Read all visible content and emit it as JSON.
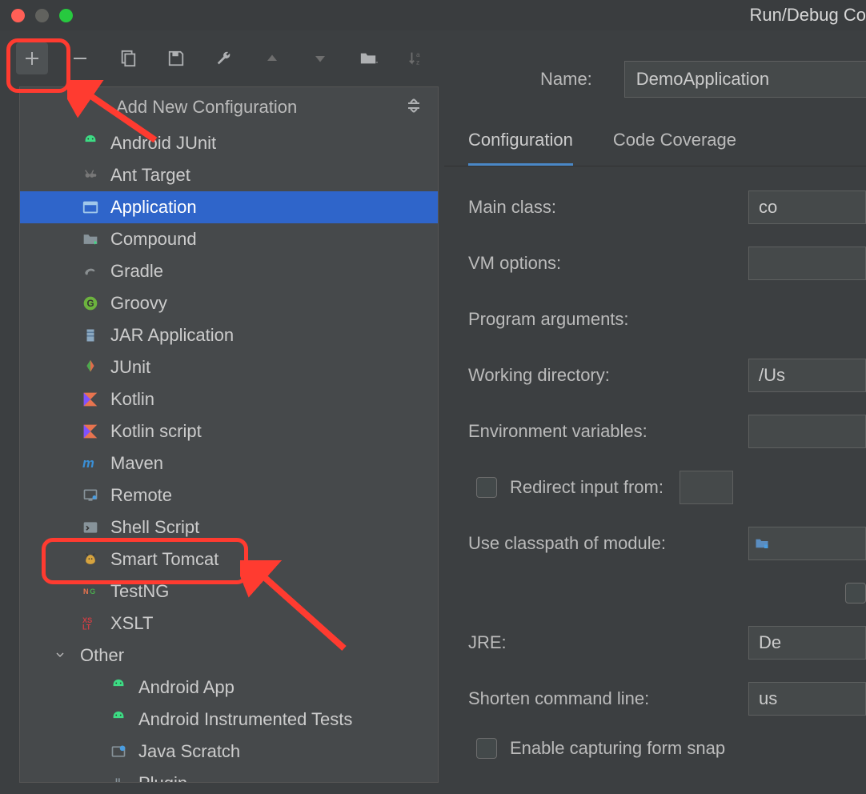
{
  "window": {
    "title": "Run/Debug Co"
  },
  "popup": {
    "title": "Add New Configuration",
    "items": [
      {
        "label": "Android JUnit",
        "icon": "android",
        "color": "#3ddc84"
      },
      {
        "label": "Ant Target",
        "icon": "ant",
        "color": "#787878"
      },
      {
        "label": "Application",
        "icon": "app",
        "color": "#a0c7ea",
        "selected": true
      },
      {
        "label": "Compound",
        "icon": "folder",
        "color": "#87939a"
      },
      {
        "label": "Gradle",
        "icon": "gradle",
        "color": "#8a8f91"
      },
      {
        "label": "Groovy",
        "icon": "groovy",
        "color": "#6cb33e"
      },
      {
        "label": "JAR Application",
        "icon": "jar",
        "color": "#8ba8c0"
      },
      {
        "label": "JUnit",
        "icon": "junit",
        "color": "#e06c4b"
      },
      {
        "label": "Kotlin",
        "icon": "kotlin",
        "color": "#e8744f"
      },
      {
        "label": "Kotlin script",
        "icon": "kotlin",
        "color": "#e8744f"
      },
      {
        "label": "Maven",
        "icon": "maven",
        "color": "#3a8fd6"
      },
      {
        "label": "Remote",
        "icon": "remote",
        "color": "#87939a"
      },
      {
        "label": "Shell Script",
        "icon": "shell",
        "color": "#87939a"
      },
      {
        "label": "Smart Tomcat",
        "icon": "tomcat",
        "color": "#d6a33e"
      },
      {
        "label": "TestNG",
        "icon": "testng",
        "color": "#cc3e44"
      },
      {
        "label": "XSLT",
        "icon": "xslt",
        "color": "#cc3e44"
      }
    ],
    "other": {
      "label": "Other",
      "items": [
        {
          "label": "Android App",
          "icon": "android",
          "color": "#3ddc84"
        },
        {
          "label": "Android Instrumented Tests",
          "icon": "android",
          "color": "#3ddc84"
        },
        {
          "label": "Java Scratch",
          "icon": "scratch",
          "color": "#87939a"
        },
        {
          "label": "Plugin",
          "icon": "plugin",
          "color": "#87939a"
        }
      ]
    }
  },
  "form": {
    "name_label": "Name:",
    "name_value": "DemoApplication",
    "tabs": [
      {
        "label": "Configuration",
        "active": true
      },
      {
        "label": "Code Coverage",
        "active": false
      }
    ],
    "fields": {
      "main_class": {
        "label": "Main class:",
        "value": "co"
      },
      "vm_options": {
        "label": "VM options:",
        "value": ""
      },
      "program_args": {
        "label": "Program arguments:",
        "value": ""
      },
      "working_dir": {
        "label": "Working directory:",
        "value": "/Us"
      },
      "env_vars": {
        "label": "Environment variables:",
        "value": ""
      },
      "redirect": {
        "label": "Redirect input from:",
        "checked": false
      },
      "classpath": {
        "label": "Use classpath of module:",
        "value": ""
      },
      "jre": {
        "label": "JRE:",
        "value": "De"
      },
      "shorten": {
        "label": "Shorten command line:",
        "value": "us"
      },
      "snapshot": {
        "label": "Enable capturing form snap",
        "checked": false
      }
    }
  }
}
